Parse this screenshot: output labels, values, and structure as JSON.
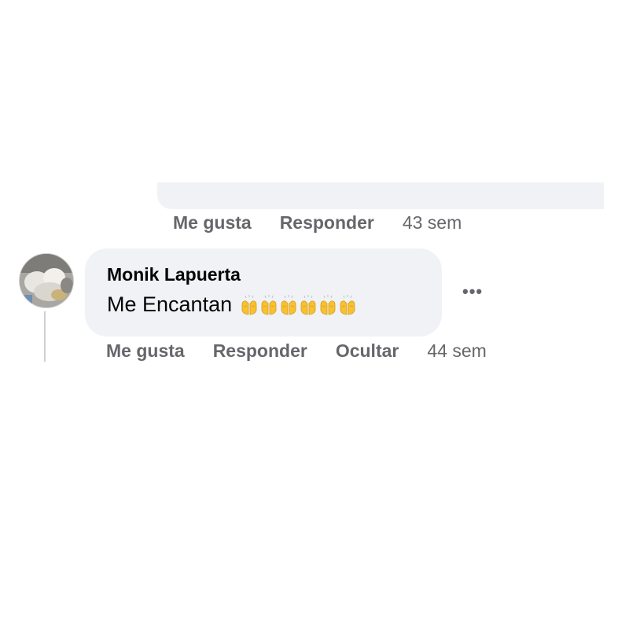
{
  "previous_comment": {
    "actions": {
      "like_label": "Me gusta",
      "reply_label": "Responder",
      "time": "43 sem"
    }
  },
  "comment": {
    "author": "Monik Lapuerta",
    "text": "Me Encantan",
    "emoji": "clapping-hands-icon",
    "emoji_count": 6,
    "actions": {
      "like_label": "Me gusta",
      "reply_label": "Responder",
      "hide_label": "Ocultar",
      "time": "44 sem"
    },
    "more_label": "•••"
  },
  "colors": {
    "bubble": "#f0f2f5",
    "action_text": "#65676b",
    "text": "#050505",
    "emoji": "#f7c12f"
  }
}
